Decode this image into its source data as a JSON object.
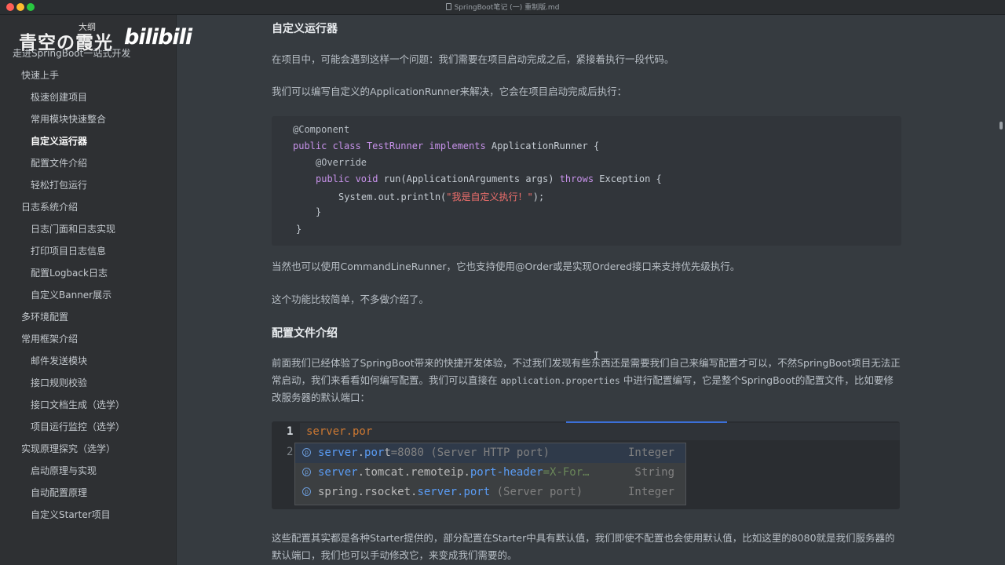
{
  "window": {
    "title": "SpringBoot笔记 (一) 重制版.md"
  },
  "watermark": {
    "brand": "青空の霞光",
    "platform": "bilibili"
  },
  "sidebar": {
    "outline_label": "大纲",
    "items": [
      {
        "label": "走进SpringBoot一站式开发",
        "level": 0,
        "active": false
      },
      {
        "label": "快速上手",
        "level": 1,
        "active": false
      },
      {
        "label": "极速创建项目",
        "level": 2,
        "active": false
      },
      {
        "label": "常用模块快速整合",
        "level": 2,
        "active": false
      },
      {
        "label": "自定义运行器",
        "level": 2,
        "active": true
      },
      {
        "label": "配置文件介绍",
        "level": 2,
        "active": false
      },
      {
        "label": "轻松打包运行",
        "level": 2,
        "active": false
      },
      {
        "label": "日志系统介绍",
        "level": 1,
        "active": false
      },
      {
        "label": "日志门面和日志实现",
        "level": 2,
        "active": false
      },
      {
        "label": "打印项目日志信息",
        "level": 2,
        "active": false
      },
      {
        "label": "配置Logback日志",
        "level": 2,
        "active": false
      },
      {
        "label": "自定义Banner展示",
        "level": 2,
        "active": false
      },
      {
        "label": "多环境配置",
        "level": 1,
        "active": false
      },
      {
        "label": "常用框架介绍",
        "level": 1,
        "active": false
      },
      {
        "label": "邮件发送模块",
        "level": 2,
        "active": false
      },
      {
        "label": "接口规则校验",
        "level": 2,
        "active": false
      },
      {
        "label": "接口文档生成（选学）",
        "level": 2,
        "active": false
      },
      {
        "label": "项目运行监控（选学）",
        "level": 2,
        "active": false
      },
      {
        "label": "实现原理探究（选学）",
        "level": 1,
        "active": false
      },
      {
        "label": "启动原理与实现",
        "level": 2,
        "active": false
      },
      {
        "label": "自动配置原理",
        "level": 2,
        "active": false
      },
      {
        "label": "自定义Starter项目",
        "level": 2,
        "active": false
      }
    ]
  },
  "main": {
    "h_runner": "自定义运行器",
    "p1": "在项目中，可能会遇到这样一个问题：我们需要在项目启动完成之后，紧接着执行一段代码。",
    "p2": "我们可以编写自定义的ApplicationRunner来解决，它会在项目启动完成后执行：",
    "code": {
      "l1": "@Component",
      "l2_kw1": "public class",
      "l2_cls": "TestRunner",
      "l2_kw2": "implements",
      "l2_rest": "ApplicationRunner {",
      "l3": "@Override",
      "l4_kw1": "public void",
      "l4_mid": "run(ApplicationArguments args)",
      "l4_kw2": "throws",
      "l4_rest": "Exception {",
      "l5_a": "System.out.println(",
      "l5_str": "\"我是自定义执行！\"",
      "l5_b": ");",
      "l6": "}",
      "l7": "}"
    },
    "p3": "当然也可以使用CommandLineRunner，它也支持使用@Order或是实现Ordered接口来支持优先级执行。",
    "p4": "这个功能比较简单，不多做介绍了。",
    "h_config": "配置文件介绍",
    "p5_a": "前面我们已经体验了SpringBoot带来的快捷开发体验，不过我们发现有些东西还是需要我们自己来编写配置才可以，不然SpringBoot项目无法正常启动，我们来看看如何编写配置。我们可以直接在",
    "p5_code": "application.properties",
    "p5_b": "中进行配置编写，它是整个SpringBoot的配置文件，比如要修改服务器的默认端口：",
    "editor": {
      "line1_num": "1",
      "line1_text": "server.por",
      "line2_num": "2",
      "completions": [
        {
          "p1": "server",
          "dot": ".",
          "p2": "por",
          "p3": "t",
          "extra": "=8080 (Server HTTP port)",
          "type": "Integer"
        },
        {
          "p1": "server",
          "dot": ".",
          "p2": "tomcat.remoteip.",
          "p3": "port-header",
          "extra": "=X-For…",
          "type": "String"
        },
        {
          "p1": "spring.rsocket.",
          "dot": "",
          "p2": "server.port",
          "p3": "",
          "extra": " (Server port)",
          "type": "Integer"
        }
      ]
    },
    "p6": "这些配置其实都是各种Starter提供的，部分配置在Starter中具有默认值，我们即使不配置也会使用默认值，比如这里的8080就是我们服务器的默认端口，我们也可以手动修改它，来变成我们需要的。"
  }
}
